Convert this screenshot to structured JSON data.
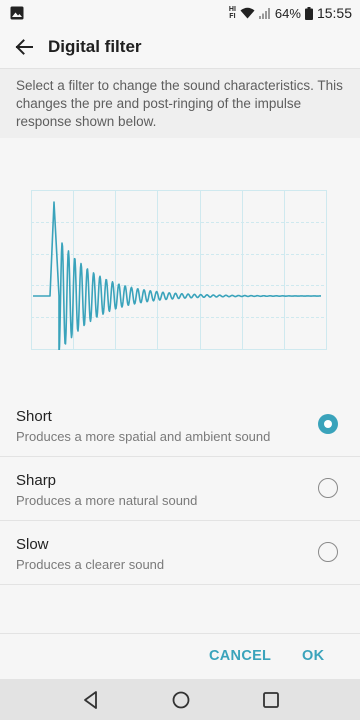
{
  "status_bar": {
    "hifi_top": "HI",
    "hifi_bottom": "FI",
    "battery": "64%",
    "time": "15:55",
    "icons": [
      "image-notification-icon",
      "hifi-icon",
      "wifi-icon",
      "signal-icon",
      "battery-icon"
    ]
  },
  "app_bar": {
    "title": "Digital filter",
    "back_icon": "arrow-left-icon"
  },
  "description": "Select a filter to change the sound characteristics. This changes the pre and post-ringing of the impulse response shown below.",
  "options": [
    {
      "label": "Short",
      "description": "Produces a more spatial and ambient sound",
      "selected": true
    },
    {
      "label": "Sharp",
      "description": "Produces a more natural sound",
      "selected": false
    },
    {
      "label": "Slow",
      "description": "Produces a clearer sound",
      "selected": false
    }
  ],
  "actions": {
    "cancel": "CANCEL",
    "ok": "OK"
  },
  "nav_bar": {
    "icons": [
      "nav-back-icon",
      "nav-home-icon",
      "nav-recents-icon"
    ]
  },
  "colors": {
    "accent": "#3aa3bb",
    "grid": "#cfe9ef",
    "waveform": "#3aa3bb",
    "description_bg": "#efefef",
    "nav_bg": "#e3e3e3"
  }
}
